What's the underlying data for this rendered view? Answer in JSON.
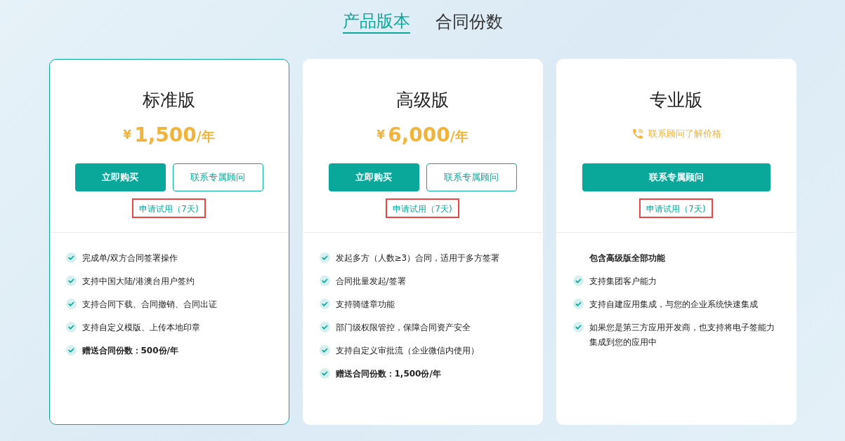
{
  "tabs": [
    {
      "label": "产品版本",
      "selected": true
    },
    {
      "label": "合同份数",
      "selected": false
    }
  ],
  "plans": [
    {
      "name": "标准版",
      "selected": true,
      "price": {
        "kind": "amount",
        "currency": "¥",
        "amount": "1,500",
        "unit": "/年"
      },
      "buttons": [
        {
          "label": "立即购买",
          "kind": "primary"
        },
        {
          "label": "联系专属顾问",
          "kind": "outline"
        }
      ],
      "trial": {
        "label": "申请试用（7天)",
        "highlighted": true
      },
      "features": [
        {
          "text": "完成单/双方合同签署操作",
          "kind": "check",
          "bold": false
        },
        {
          "text": "支持中国大陆/港澳台用户签约",
          "kind": "check",
          "bold": false
        },
        {
          "text": "支持合同下载、合同撤销、合同出证",
          "kind": "check",
          "bold": false
        },
        {
          "text": "支持自定义模版、上传本地印章",
          "kind": "check",
          "bold": false
        },
        {
          "text": "赠送合同份数：500份/年",
          "kind": "check",
          "bold": true
        }
      ]
    },
    {
      "name": "高级版",
      "selected": false,
      "price": {
        "kind": "amount",
        "currency": "¥",
        "amount": "6,000",
        "unit": "/年"
      },
      "buttons": [
        {
          "label": "立即购买",
          "kind": "primary"
        },
        {
          "label": "联系专属顾问",
          "kind": "outline"
        }
      ],
      "trial": {
        "label": "申请试用（7天)",
        "highlighted": true
      },
      "features": [
        {
          "text": "发起多方（人数≥3）合同，适用于多方签署",
          "kind": "check",
          "bold": false
        },
        {
          "text": "合同批量发起/签署",
          "kind": "check",
          "bold": false
        },
        {
          "text": "支持骑缝章功能",
          "kind": "check",
          "bold": false
        },
        {
          "text": "部门级权限管控，保障合同资产安全",
          "kind": "check",
          "bold": false
        },
        {
          "text": "支持自定义审批流（企业微信内使用）",
          "kind": "check",
          "bold": false
        },
        {
          "text": "赠送合同份数：1,500份/年",
          "kind": "check",
          "bold": true
        }
      ]
    },
    {
      "name": "专业版",
      "selected": false,
      "price": {
        "kind": "contact",
        "text": "联系顾问了解价格"
      },
      "buttons": [
        {
          "label": "联系专属顾问",
          "kind": "primary"
        }
      ],
      "trial": {
        "label": "申请试用（7天)",
        "highlighted": true
      },
      "features": [
        {
          "text": "包含高级版全部功能",
          "kind": "heading",
          "bold": true
        },
        {
          "text": "支持集团客户能力",
          "kind": "check",
          "bold": false
        },
        {
          "text": "支持自建应用集成，与您的企业系统快速集成",
          "kind": "check",
          "bold": false
        },
        {
          "text": "如果您是第三方应用开发商，也支持将电子签能力集成到您的应用中",
          "kind": "check",
          "bold": false
        }
      ]
    }
  ]
}
